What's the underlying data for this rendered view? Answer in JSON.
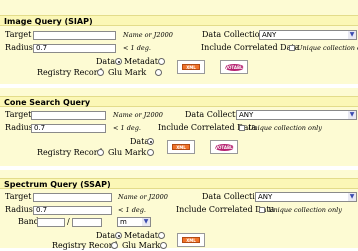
{
  "siap": {
    "title": "Image Query (SIAP)",
    "target_label": "Target",
    "target_value": "",
    "target_hint": "Name or J2000",
    "radius_label": "Radius",
    "radius_value": "0.7",
    "radius_hint": "< 1 deg.",
    "collection_label": "Data Collection",
    "collection_value": "ANY",
    "correlated_label": "Include Correlated Data",
    "unique_label": "Unique collection only",
    "data_label": "Data",
    "metadata_label": "Metadata",
    "registry_label": "Registry Record",
    "glumark_label": "Glu Mark",
    "xml_label": "XML",
    "votable_label": "VOTABLE"
  },
  "cone": {
    "title": "Cone Search Query",
    "target_label": "Target",
    "target_value": "",
    "target_hint": "Name or J2000",
    "radius_label": "Radius",
    "radius_value": "0.7",
    "radius_hint": "< 1 deg.",
    "collection_label": "Data Collection",
    "collection_value": "ANY",
    "correlated_label": "Include Correlated Data",
    "unique_label": "Unique collection only",
    "data_label": "Data",
    "registry_label": "Registry Record",
    "glumark_label": "Glu Mark",
    "xml_label": "XML",
    "votable_label": "VOTABLE"
  },
  "ssap": {
    "title": "Spectrum Query (SSAP)",
    "target_label": "Target",
    "target_value": "",
    "target_hint": "Name or J2000",
    "radius_label": "Radius",
    "radius_value": "0.7",
    "radius_hint": "< 1 deg.",
    "band_label": "Band",
    "band_sep": "/",
    "band_unit": "m",
    "collection_label": "Data Collection",
    "collection_value": "ANY",
    "correlated_label": "Include Correlated Data",
    "unique_label": "Unique collection only",
    "data_label": "Data",
    "metadata_label": "Metadata",
    "registry_label": "Registry Record",
    "glumark_label": "Glu Mark",
    "xml_label": "XML"
  },
  "icons": {
    "dropdown": "chevron-down-icon"
  }
}
